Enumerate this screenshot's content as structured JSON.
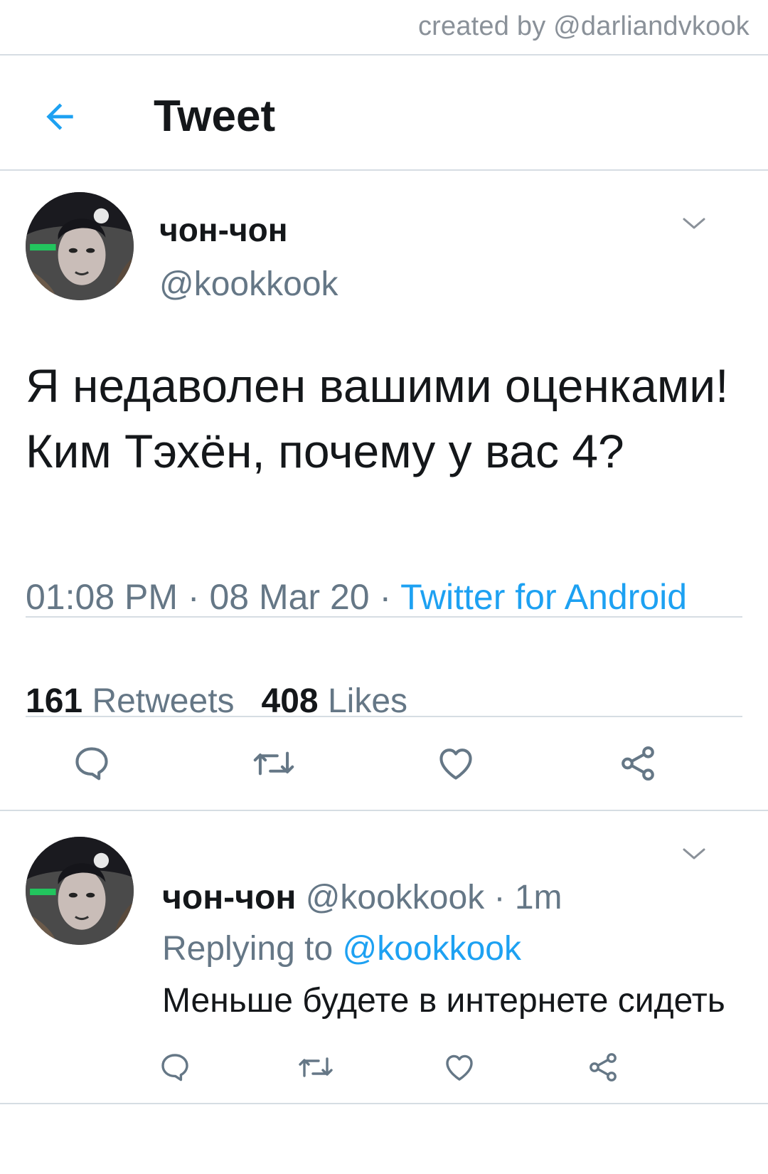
{
  "credit": "created by @darliandvkook",
  "header": {
    "title": "Tweet"
  },
  "tweet": {
    "display_name": "чон-чон",
    "handle": "@kookkook",
    "text": "Я недаволен вашими оценками! Ким Тэхён, почему у вас 4?",
    "time": "01:08 PM",
    "separator": " · ",
    "date": "08 Mar 20",
    "source": "Twitter for Android",
    "retweet_count": "161",
    "retweet_label": "Retweets",
    "like_count": "408",
    "like_label": "Likes"
  },
  "reply": {
    "display_name": "чон-чон",
    "handle": "@kookkook",
    "time_sep": " · ",
    "time": "1m",
    "replying_label": "Replying to",
    "replying_to": "@kookkook",
    "text": "Меньше будете в интернете сидеть"
  },
  "icons": {
    "back": "arrow-left-icon",
    "chevron": "chevron-down-icon",
    "reply": "comment-icon",
    "retweet": "retweet-icon",
    "like": "heart-icon",
    "share": "share-icon"
  },
  "colors": {
    "accent": "#1da1f2",
    "text": "#14171a",
    "secondary": "#657786",
    "divider": "#d6dde3",
    "icon": "#657786"
  }
}
